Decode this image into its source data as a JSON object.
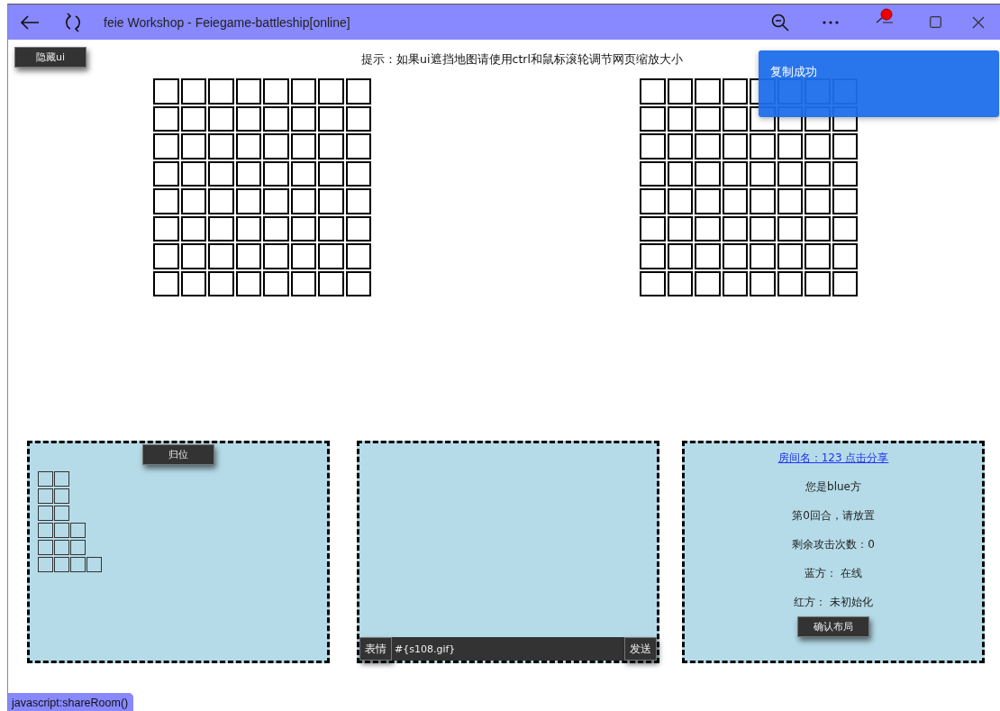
{
  "window": {
    "title": "feie Workshop - Feiegame-battleship[online]"
  },
  "hide_ui_button": "隐藏ui",
  "hint": "提示：如果ui遮挡地图请使用ctrl和鼠标滚轮调节网页缩放大小",
  "toast": "复制成功",
  "fleet_panel": {
    "reset_button": "归位"
  },
  "chat_panel": {
    "emoji_button": "表情",
    "message_input": {
      "value": "#{s108.gif}"
    },
    "send_button": "发送"
  },
  "info_panel": {
    "share_link": "房间名：123 点击分享",
    "lines": [
      "您是blue方",
      "第0回合，请放置",
      "剩余攻击次数：0",
      "蓝方： 在线",
      "红方： 未初始化"
    ],
    "confirm_button": "确认布局"
  },
  "status_bar": "javascript:shareRoom()"
}
